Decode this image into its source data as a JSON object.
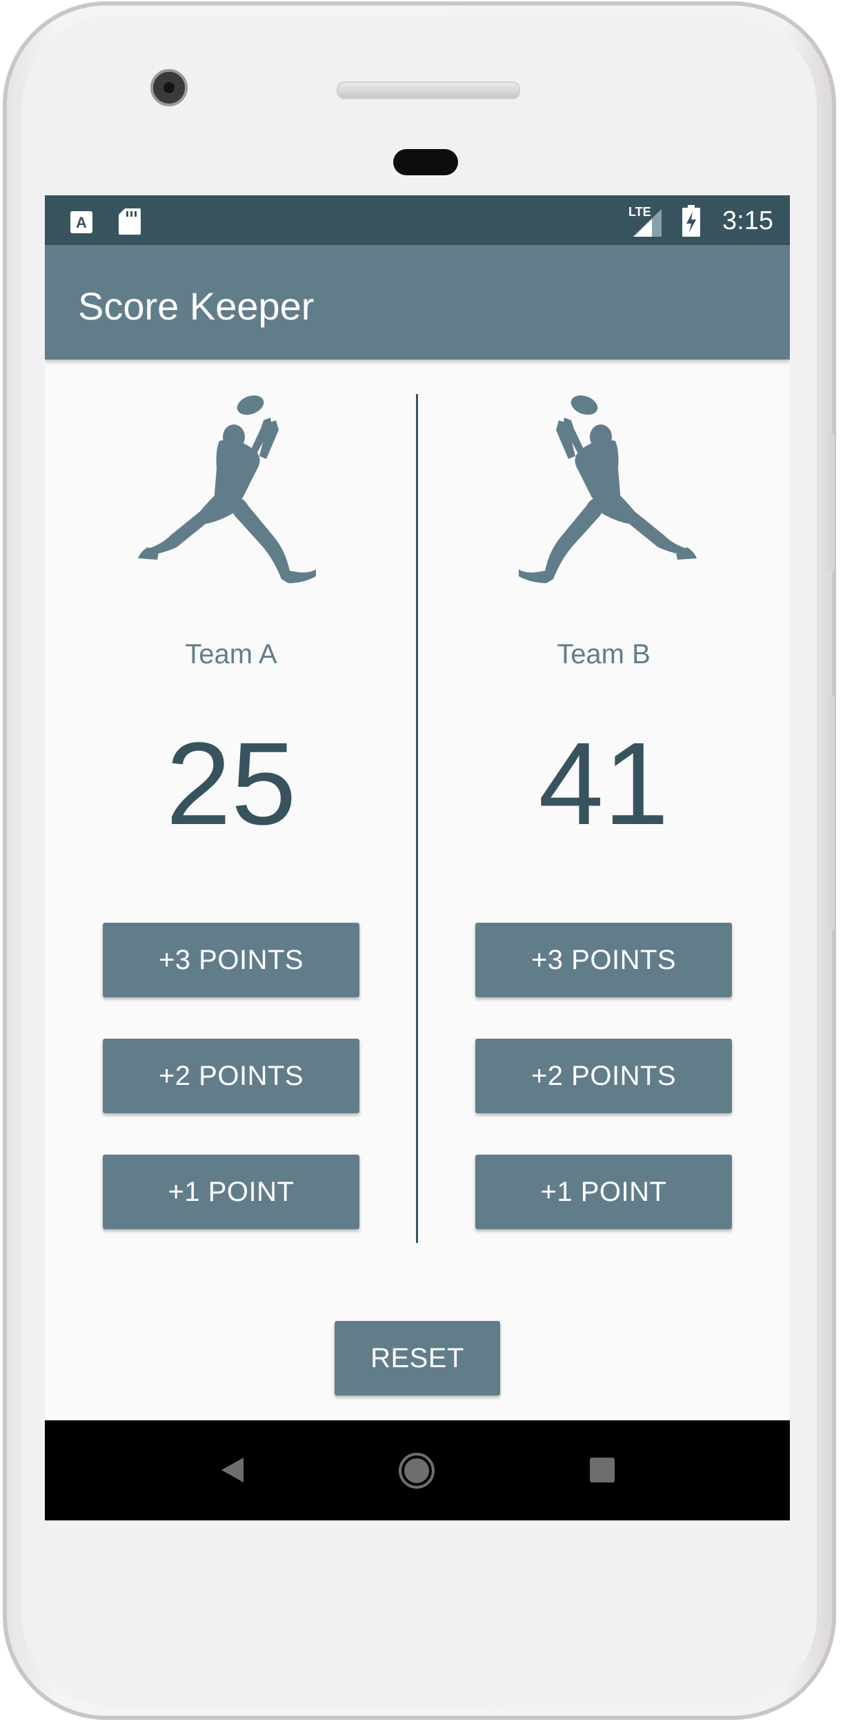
{
  "status_bar": {
    "time": "3:15",
    "network": "LTE",
    "left_icons": [
      "accessibility-a-icon",
      "sd-card-icon"
    ],
    "right_icons": [
      "signal-icon",
      "battery-charging-icon"
    ]
  },
  "app_bar": {
    "title": "Score Keeper"
  },
  "team_a": {
    "name": "Team A",
    "score": "25",
    "icon": "football-player-catch-icon",
    "buttons": {
      "three": "+3 POINTS",
      "two": "+2 POINTS",
      "one": "+1 POINT"
    }
  },
  "team_b": {
    "name": "Team B",
    "score": "41",
    "icon": "football-player-catch-icon",
    "buttons": {
      "three": "+3 POINTS",
      "two": "+2 POINTS",
      "one": "+1 POINT"
    }
  },
  "reset_label": "RESET",
  "nav_bar": {
    "icons": [
      "back-icon",
      "home-icon",
      "recents-icon"
    ]
  },
  "colors": {
    "primary": "#627d8a",
    "primary_dark": "#37535e",
    "background": "#fafafa",
    "on_primary": "#ffffff"
  }
}
